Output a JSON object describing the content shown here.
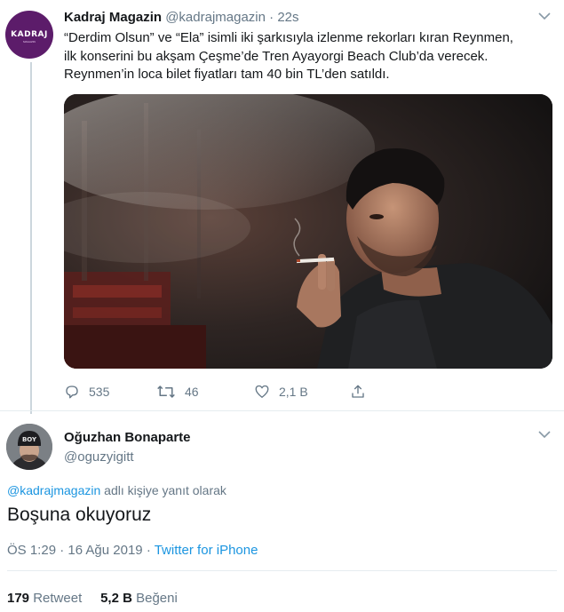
{
  "original_tweet": {
    "author_name": "Kadraj Magazin",
    "author_handle": "@kadrajmagazin",
    "separator": "·",
    "time_ago": "22s",
    "avatar_logo_text": "KADRAJ",
    "text_lines": [
      "“Derdim Olsun” ve “Ela” isimli iki şarkısıyla izlenme rekorları kıran Reynmen,",
      "ilk konserini bu akşam Çeşme’de Tren Ayayorgi Beach Club’da verecek.",
      "Reynmen’in loca bilet fiyatları tam 40 bin TL’den satıldı."
    ],
    "actions": {
      "replies": "535",
      "retweets": "46",
      "likes": "2,1 B"
    }
  },
  "reply_tweet": {
    "author_name": "Oğuzhan Bonaparte",
    "author_handle": "@oguzyigitt",
    "replying_to_mention": "@kadrajmagazin",
    "replying_to_suffix": " adlı kişiye yanıt olarak",
    "text": "Boşuna okuyoruz",
    "time": "ÖS 1:29",
    "date_sep": " · ",
    "date": "16 Ağu 2019",
    "source": "Twitter for iPhone",
    "retweet_count": "179",
    "retweet_label": "Retweet",
    "like_count": "5,2 B",
    "like_label": "Beğeni",
    "avatar_cap_text": "BOY"
  },
  "colors": {
    "text_primary": "#14171a",
    "text_secondary": "#657786",
    "link": "#1b95e0",
    "divider": "#e6ecf0",
    "thread_line": "#ccd6dd",
    "kadraj_brand": "#5c1c6a"
  },
  "icons": {
    "reply": "comment-bubble-icon",
    "retweet": "retweet-arrows-icon",
    "like": "heart-outline-icon",
    "share": "share-upload-icon",
    "menu": "chevron-down-icon"
  }
}
